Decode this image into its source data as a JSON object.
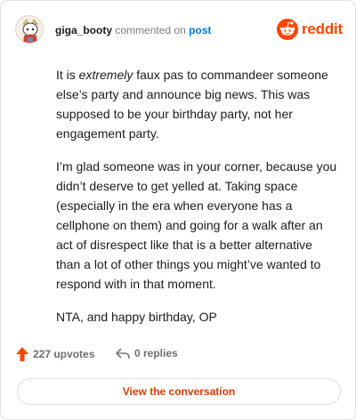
{
  "header": {
    "username": "giga_booty",
    "commented_on": "commented on",
    "post_link": "post",
    "brand": "reddit"
  },
  "comment": {
    "p1_before": "It is ",
    "p1_em": "extremely",
    "p1_after": " faux pas to commandeer someone else’s party and announce big news. This was supposed to be your birthday party, not her engagement party.",
    "p2": "I’m glad someone was in your corner, because you didn’t deserve to get yelled at. Taking space (especially in the era when everyone has a cellphone on them) and going for a walk after an act of disrespect like that is a better alternative than a lot of other things you might’ve wanted to respond with in that moment.",
    "p3": "NTA, and happy birthday, OP"
  },
  "actions": {
    "upvotes": "227 upvotes",
    "replies": "0 replies"
  },
  "cta": {
    "label": "View the conversation"
  },
  "colors": {
    "accent": "#ff4500",
    "link": "#0079d3",
    "cta_text": "#d93a00"
  }
}
